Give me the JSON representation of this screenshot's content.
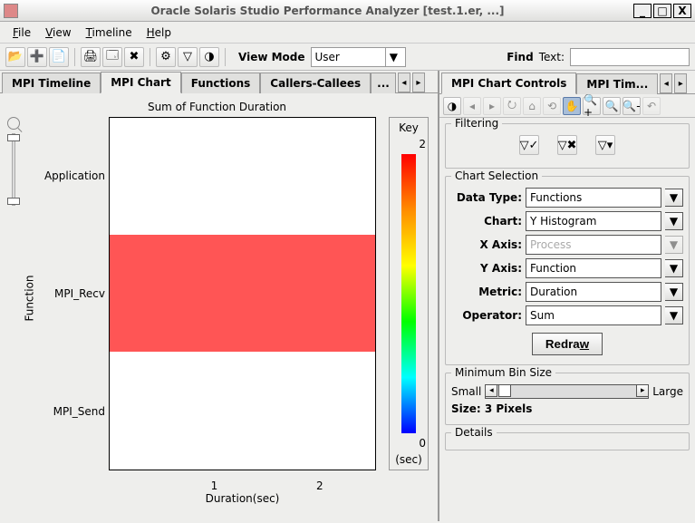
{
  "titlebar": {
    "title": "Oracle Solaris Studio Performance Analyzer [test.1.er, ...]",
    "minimize": "_",
    "maximize": "□",
    "close": "X"
  },
  "menubar": {
    "file": "File",
    "view": "View",
    "timeline": "Timeline",
    "help": "Help"
  },
  "toolbar": {
    "view_mode_label": "View Mode",
    "view_mode_value": "User",
    "find_label": "Find",
    "find_field_label": "Text:"
  },
  "left_tabs": {
    "mpi_timeline": "MPI Timeline",
    "mpi_chart": "MPI Chart",
    "functions": "Functions",
    "callers_callees": "Callers-Callees",
    "more": "..."
  },
  "chart": {
    "title": "Sum of Function Duration",
    "ylabel": "Function",
    "yticks": {
      "0": "Application",
      "1": "MPI_Recv",
      "2": "MPI_Send"
    },
    "xlabel": "Duration(sec)",
    "xticks": {
      "1": "1",
      "2": "2"
    },
    "key_label": "Key",
    "key_max": "2",
    "key_min": "0",
    "key_unit": "(sec)"
  },
  "right_tabs": {
    "controls": "MPI Chart Controls",
    "timeline_controls": "MPI Tim..."
  },
  "filtering": {
    "legend": "Filtering"
  },
  "chart_selection": {
    "legend": "Chart Selection",
    "data_type_label": "Data Type:",
    "data_type_value": "Functions",
    "chart_label": "Chart:",
    "chart_value": "Y Histogram",
    "x_axis_label": "X Axis:",
    "x_axis_value": "Process",
    "y_axis_label": "Y Axis:",
    "y_axis_value": "Function",
    "metric_label": "Metric:",
    "metric_value": "Duration",
    "operator_label": "Operator:",
    "operator_value": "Sum",
    "redraw": "Redraw"
  },
  "bin": {
    "legend": "Minimum Bin Size",
    "small": "Small",
    "large": "Large",
    "size": "Size: 3 Pixels"
  },
  "details": {
    "legend": "Details"
  },
  "chart_data": {
    "type": "bar",
    "orientation": "horizontal",
    "title": "Sum of Function Duration",
    "xlabel": "Duration(sec)",
    "ylabel": "Function",
    "categories": [
      "Application",
      "MPI_Recv",
      "MPI_Send"
    ],
    "values": [
      0.05,
      2.4,
      0.02
    ],
    "color_values": [
      0,
      2,
      0
    ],
    "colormap": "jet",
    "colorbar": {
      "label": "(sec)",
      "min": 0,
      "max": 2
    },
    "xlim": [
      0,
      2.5
    ]
  }
}
